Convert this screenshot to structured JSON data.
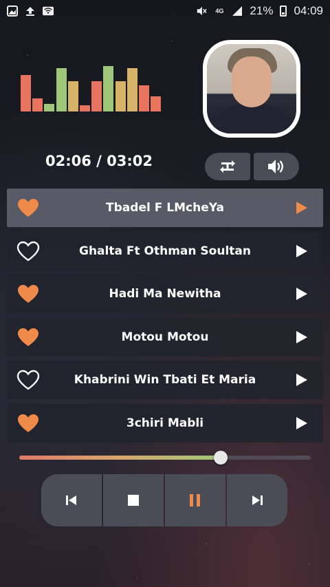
{
  "status_bar": {
    "battery_percent": "21%",
    "time": "04:09",
    "network": "4G",
    "icons": [
      "gallery-icon",
      "upload-icon",
      "wifi-icon",
      "mute-icon",
      "signal-icon",
      "battery-icon"
    ]
  },
  "equalizer": {
    "bars": [
      {
        "level": 0.74,
        "color": "#e8735f"
      },
      {
        "level": 0.26,
        "color": "#e8735f"
      },
      {
        "level": 0.15,
        "color": "#9fc77a"
      },
      {
        "level": 0.88,
        "color": "#9fc77a"
      },
      {
        "level": 0.61,
        "color": "#d7b36a"
      },
      {
        "level": 0.13,
        "color": "#e8735f"
      },
      {
        "level": 0.61,
        "color": "#e8735f"
      },
      {
        "level": 0.92,
        "color": "#9fc77a"
      },
      {
        "level": 0.61,
        "color": "#d7b36a"
      },
      {
        "level": 0.87,
        "color": "#d7b36a"
      },
      {
        "level": 0.53,
        "color": "#e8735f"
      },
      {
        "level": 0.31,
        "color": "#e8735f"
      }
    ]
  },
  "player": {
    "time_display": "02:06 / 03:02",
    "progress": 0.69,
    "accent_color": "#f08a4b"
  },
  "songs": [
    {
      "title": "Tbadel F LMcheYa",
      "liked": true,
      "active": true
    },
    {
      "title": "Ghalta Ft Othman Soultan",
      "liked": false,
      "active": false
    },
    {
      "title": "Hadi Ma Newitha",
      "liked": true,
      "active": false
    },
    {
      "title": "Motou Motou",
      "liked": true,
      "active": false
    },
    {
      "title": "Khabrini Win Tbati Et Maria",
      "liked": false,
      "active": false
    },
    {
      "title": "3chiri Mabli",
      "liked": true,
      "active": false
    }
  ]
}
